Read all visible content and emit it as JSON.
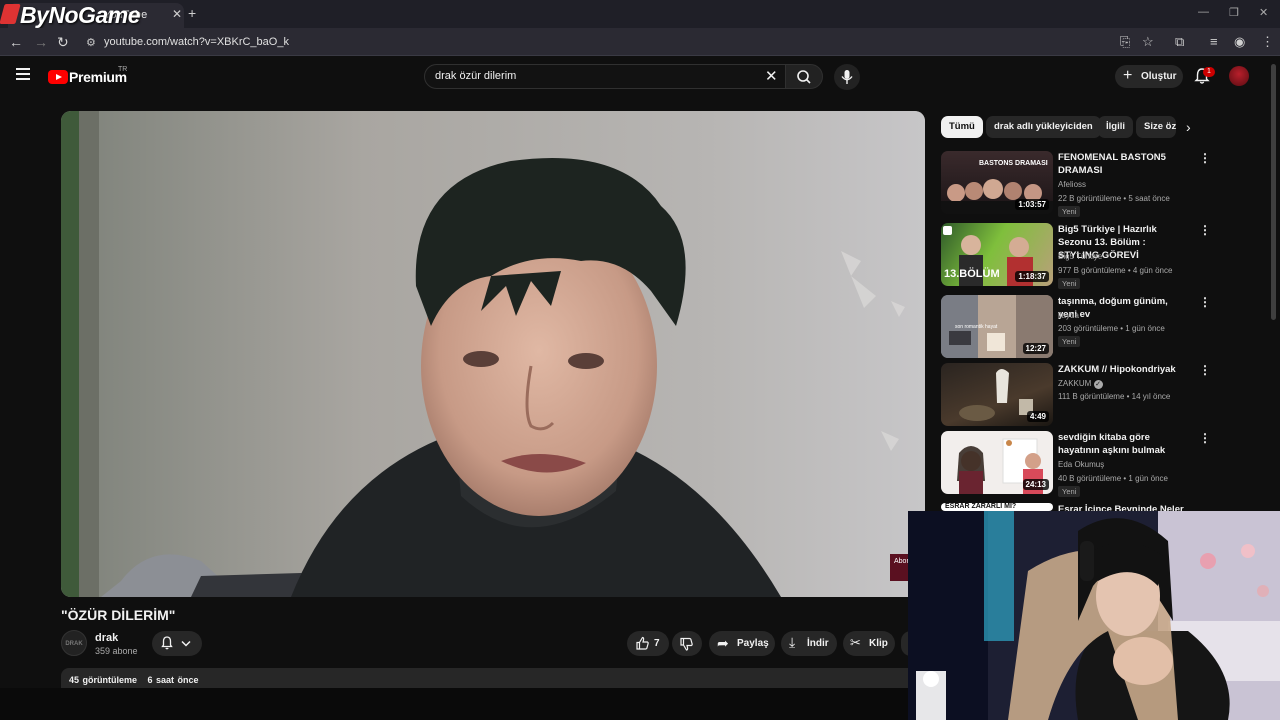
{
  "watermark": "ByNoGame",
  "browser": {
    "tab_title": "YouTube",
    "url": "youtube.com/watch?v=XBKrC_baO_k"
  },
  "header": {
    "logo_text": "Premium",
    "region": "TR",
    "search_value": "drak özür dilerim",
    "create_label": "Oluştur",
    "notification_count": "1"
  },
  "video": {
    "title": "\"ÖZÜR DİLERİM\"",
    "channel_avatar_text": "DRAK",
    "channel_name": "drak",
    "subscribers": "359 abone",
    "like_count": "7",
    "share_label": "Paylaş",
    "download_label": "İndir",
    "clip_label": "Klip",
    "views": "45 görüntüleme",
    "posted": "6 saat önce",
    "overlay_text": "Abon"
  },
  "chips": [
    "Tümü",
    "drak adlı yükleyiciden",
    "İlgili",
    "Size öz"
  ],
  "recommendations": [
    {
      "title": "FENOMENAL BASTON5 DRAMASI",
      "channel": "Afelioss",
      "meta": "22 B görüntüleme • 5 saat önce",
      "badge": "Yeni",
      "duration": "1:03:57",
      "thumb_text": "BASTONS DRAMASI"
    },
    {
      "title": "Big5 Türkiye | Hazırlık Sezonu 13. Bölüm : STYLING GÖREVİ",
      "channel": "Big5 Türkiye",
      "meta": "977 B görüntüleme • 4 gün önce",
      "badge": "Yeni",
      "duration": "1:18:37",
      "thumb_text": "13.BÖLÜM"
    },
    {
      "title": "taşınma, doğum günüm, yeni ev",
      "channel": "ilayda",
      "meta": "203 görüntüleme • 1 gün önce",
      "badge": "Yeni",
      "duration": "12:27",
      "thumb_text": "son romantik hayat"
    },
    {
      "title": "ZAKKUM // Hipokondriyak",
      "channel": "ZAKKUM",
      "meta": "111 B görüntüleme • 14 yıl önce",
      "badge": "",
      "duration": "4:49",
      "thumb_text": ""
    },
    {
      "title": "sevdiğin kitaba göre hayatının aşkını bulmak",
      "channel": "Eda Okumuş",
      "meta": "40 B görüntüleme • 1 gün önce",
      "badge": "Yeni",
      "duration": "24:13",
      "thumb_text": ""
    },
    {
      "title": "Esrar İçince Beyninde Neler Olur",
      "thumb_text": "ESRAR ZARARLI MI?"
    }
  ]
}
